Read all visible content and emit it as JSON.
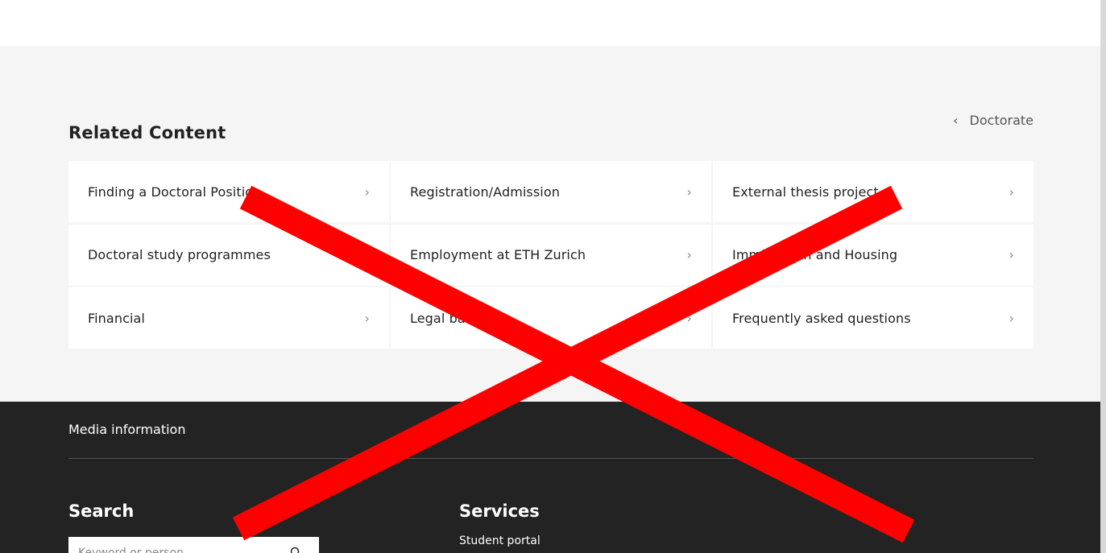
{
  "related": {
    "title": "Related Content",
    "back_label": "Doctorate",
    "cards": [
      {
        "label": "Finding a Doctoral Position"
      },
      {
        "label": "Registration/Admission"
      },
      {
        "label": "External thesis project"
      },
      {
        "label": "Doctoral study programmes"
      },
      {
        "label": "Employment at ETH Zurich"
      },
      {
        "label": "Immigration and Housing"
      },
      {
        "label": "Financial"
      },
      {
        "label": "Legal basis"
      },
      {
        "label": "Frequently asked questions"
      }
    ]
  },
  "footer": {
    "media_label": "Media information",
    "search_heading": "Search",
    "search_placeholder": "Keyword or person",
    "services_heading": "Services",
    "student_portal": "Student portal"
  },
  "icons": {
    "card_arrow": "chevron-right-icon",
    "back": "chevron-left-icon",
    "search": "search-icon"
  },
  "colors": {
    "overlay_cross": "#ff0000",
    "footer_bg": "#232323",
    "related_bg": "#f5f5f5"
  }
}
